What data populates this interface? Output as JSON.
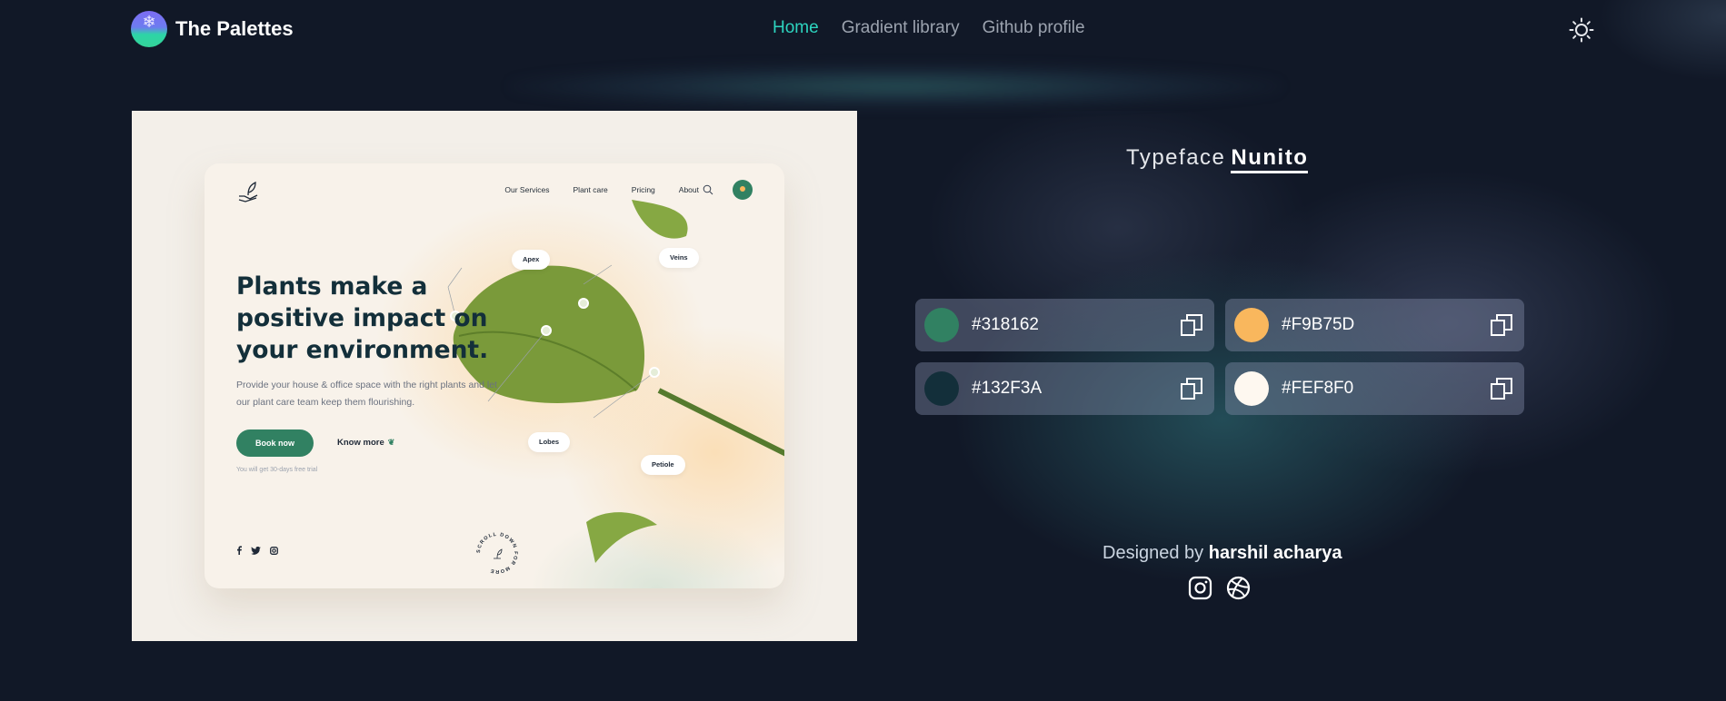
{
  "header": {
    "brand": "The Palettes",
    "nav": [
      {
        "label": "Home",
        "active": true
      },
      {
        "label": "Gradient library",
        "active": false
      },
      {
        "label": "Github profile",
        "active": false
      }
    ],
    "theme_icon": "sun-icon"
  },
  "preview": {
    "nav": [
      "Our Services",
      "Plant care",
      "Pricing",
      "About"
    ],
    "hero_title": "Plants make a positive impact on your environment.",
    "hero_desc": "Provide your house & office space with the right plants and let our plant care team keep them flourishing.",
    "book_label": "Book now",
    "know_label": "Know more",
    "trial_text": "You will get 30-days free trial",
    "leaf_labels": [
      "Apex",
      "Veins",
      "Lobes",
      "Petiole"
    ],
    "scroll_text": "SCROLL DOWN FOR MORE"
  },
  "typeface": {
    "label": "Typeface",
    "name": "Nunito"
  },
  "swatches": [
    {
      "hex": "#318162",
      "color": "#318162"
    },
    {
      "hex": "#F9B75D",
      "color": "#F9B75D"
    },
    {
      "hex": "#132F3A",
      "color": "#132F3A"
    },
    {
      "hex": "#FEF8F0",
      "color": "#FEF8F0"
    }
  ],
  "credit": {
    "prefix": "Designed by",
    "author": "harshil acharya",
    "icons": [
      "instagram-icon",
      "dribbble-icon"
    ]
  }
}
